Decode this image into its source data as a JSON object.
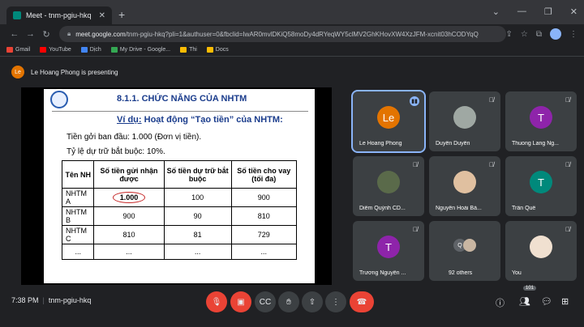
{
  "browser": {
    "tab_title": "Meet - tnm-pgiu-hkq",
    "new_tab": "+",
    "url_host": "meet.google.com",
    "url_path": "/tnm-pgiu-hkq?pli=1&authuser=0&fbclid=IwAR0mvlDKiQ58moDy4dRYeqWY5clMV2GhKHovXW4XzJFM-xcnit03hCODYqQ",
    "bookmarks": [
      "Gmail",
      "YouTube",
      "Dịch",
      "My Drive - Google...",
      "Thi",
      "Docs"
    ],
    "bookmark_colors": [
      "#ea4335",
      "#ff0000",
      "#4285f4",
      "#34a853",
      "#fbbc04",
      "#fbbc04"
    ]
  },
  "presenting": {
    "initials": "Le",
    "text": "Le Hoang Phong is presenting"
  },
  "slide": {
    "title": "8.1.1.  CHỨC NĂNG CỦA NHTM",
    "example_label": "Ví dụ:",
    "example_text": "Hoạt động “Tạo tiền” của NHTM:",
    "line1": "Tiền gởi ban đầu: 1.000 (Đơn vị tiền).",
    "line2": "Tỷ lệ dự trữ bắt buộc: 10%.",
    "table": {
      "headers": [
        "Tên NH",
        "Số tiền gửi nhận được",
        "Số tiền dự trữ bắt buộc",
        "Số tiền cho vay (tối đa)"
      ],
      "rows": [
        [
          "NHTM A",
          "1.000",
          "100",
          "900"
        ],
        [
          "NHTM B",
          "900",
          "90",
          "810"
        ],
        [
          "NHTM C",
          "810",
          "81",
          "729"
        ],
        [
          "...",
          "...",
          "...",
          "..."
        ]
      ]
    }
  },
  "participants": [
    {
      "name": "Le Hoang Phong",
      "initials": "Le",
      "color": "#e37400",
      "type": "letter",
      "state": "speaking"
    },
    {
      "name": "Duyên Duyên",
      "initials": "",
      "color": "",
      "type": "photo",
      "state": "muted"
    },
    {
      "name": "Thuong Lang Ng...",
      "initials": "T",
      "color": "#8e24aa",
      "type": "letter",
      "state": "muted"
    },
    {
      "name": "Diễm Quỳnh CD...",
      "initials": "",
      "color": "",
      "type": "photo3",
      "state": "muted"
    },
    {
      "name": "Nguyễn Hoài Bả...",
      "initials": "",
      "color": "",
      "type": "photo4",
      "state": "muted"
    },
    {
      "name": "Trần Quế",
      "initials": "T",
      "color": "#00897b",
      "type": "letter",
      "state": "muted"
    },
    {
      "name": "Trương Nguyễn ...",
      "initials": "T",
      "color": "#8e24aa",
      "type": "letter",
      "state": "muted"
    },
    {
      "name": "92 others",
      "initials": "Q",
      "color": "#5f6368",
      "type": "stack",
      "state": "none"
    },
    {
      "name": "You",
      "initials": "",
      "color": "",
      "type": "photo5",
      "state": "muted"
    }
  ],
  "bottom": {
    "time": "7:38 PM",
    "meeting_code": "tnm-pgiu-hkq",
    "participant_count": "101"
  }
}
